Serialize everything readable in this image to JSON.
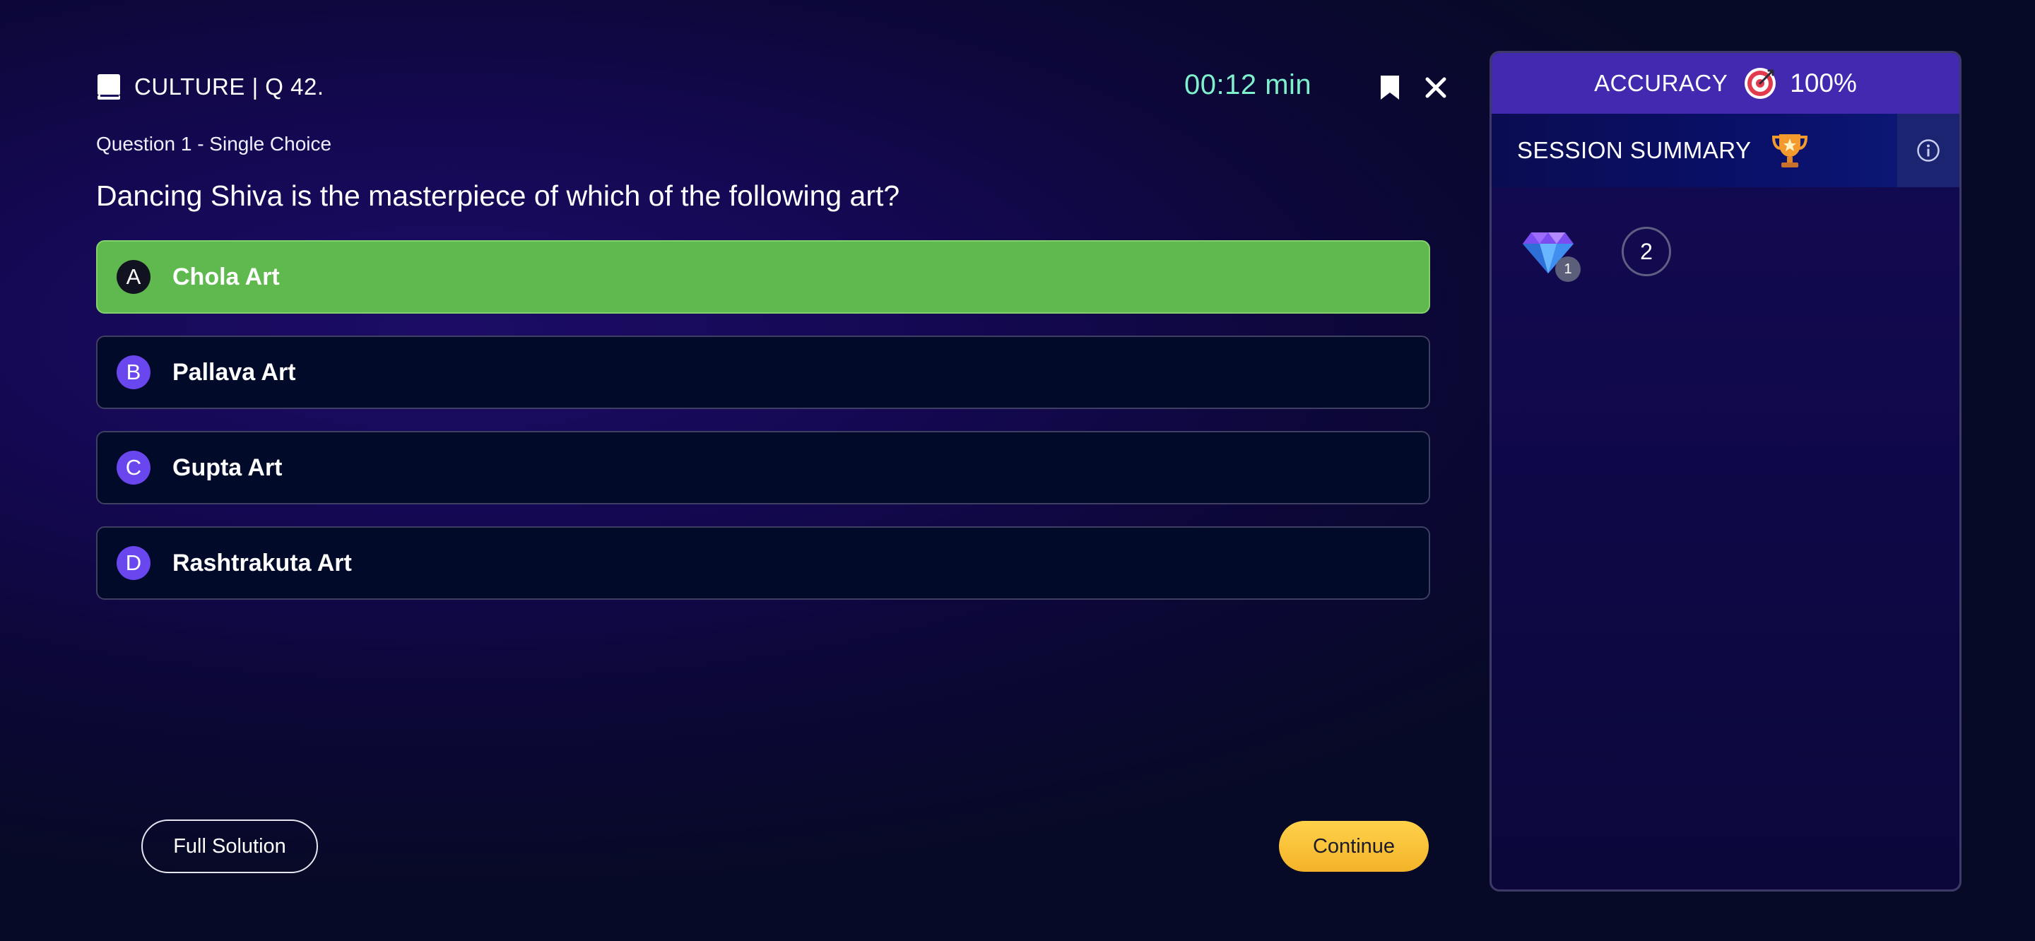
{
  "header": {
    "subject": "CULTURE | Q 42.",
    "timer": "00:12 min"
  },
  "question": {
    "meta": "Question 1 - Single Choice",
    "text": "Dancing Shiva is the masterpiece of which of the following art?"
  },
  "options": [
    {
      "letter": "A",
      "label": "Chola Art",
      "state": "correct"
    },
    {
      "letter": "B",
      "label": "Pallava Art",
      "state": "default"
    },
    {
      "letter": "C",
      "label": "Gupta Art",
      "state": "default"
    },
    {
      "letter": "D",
      "label": "Rashtrakuta Art",
      "state": "default"
    }
  ],
  "actions": {
    "full_solution": "Full Solution",
    "continue": "Continue"
  },
  "panel": {
    "accuracy_label": "ACCURACY",
    "accuracy_value": "100%",
    "summary_label": "SESSION SUMMARY",
    "gem_count": "1",
    "question_number": "2"
  },
  "icons": {
    "subject": "book-icon",
    "bookmark": "bookmark-icon",
    "close": "close-icon",
    "accuracy": "target-icon",
    "summary": "trophy-icon",
    "info": "info-icon",
    "reward": "gem-icon"
  },
  "colors": {
    "timer": "#7ef0cc",
    "correct_option": "#5fb94e",
    "option_letter": "#6a46ee",
    "continue_button": "#f3b32a",
    "accuracy_bar": "#4328b0"
  }
}
